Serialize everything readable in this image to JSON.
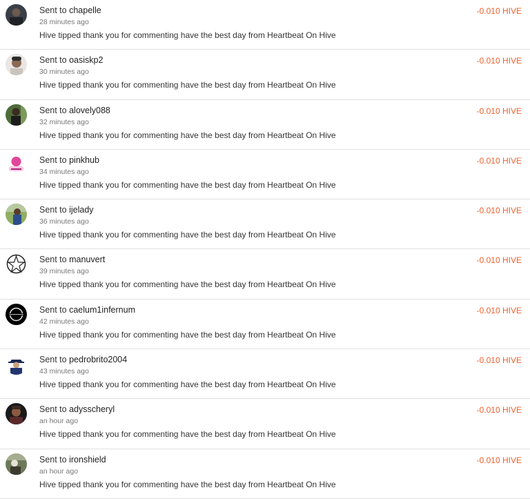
{
  "transfers": [
    {
      "prefix": "Sent to",
      "user": "chapelle",
      "time": "28 minutes ago",
      "memo": "Hive tipped thank you for commenting have the best day from Heartbeat On Hive",
      "amount": "-0.010 HIVE"
    },
    {
      "prefix": "Sent to",
      "user": "oasiskp2",
      "time": "30 minutes ago",
      "memo": "Hive tipped thank you for commenting have the best day from Heartbeat On Hive",
      "amount": "-0.010 HIVE"
    },
    {
      "prefix": "Sent to",
      "user": "alovely088",
      "time": "32 minutes ago",
      "memo": "Hive tipped thank you for commenting have the best day from Heartbeat On Hive",
      "amount": "-0.010 HIVE"
    },
    {
      "prefix": "Sent to",
      "user": "pinkhub",
      "time": "34 minutes ago",
      "memo": "Hive tipped thank you for commenting have the best day from Heartbeat On Hive",
      "amount": "-0.010 HIVE"
    },
    {
      "prefix": "Sent to",
      "user": "ijelady",
      "time": "36 minutes ago",
      "memo": "Hive tipped thank you for commenting have the best day from Heartbeat On Hive",
      "amount": "-0.010 HIVE"
    },
    {
      "prefix": "Sent to",
      "user": "manuvert",
      "time": "39 minutes ago",
      "memo": "Hive tipped thank you for commenting have the best day from Heartbeat On Hive",
      "amount": "-0.010 HIVE"
    },
    {
      "prefix": "Sent to",
      "user": "caelum1infernum",
      "time": "42 minutes ago",
      "memo": "Hive tipped thank you for commenting have the best day from Heartbeat On Hive",
      "amount": "-0.010 HIVE"
    },
    {
      "prefix": "Sent to",
      "user": "pedrobrito2004",
      "time": "43 minutes ago",
      "memo": "Hive tipped thank you for commenting have the best day from Heartbeat On Hive",
      "amount": "-0.010 HIVE"
    },
    {
      "prefix": "Sent to",
      "user": "adysscheryl",
      "time": "an hour ago",
      "memo": "Hive tipped thank you for commenting have the best day from Heartbeat On Hive",
      "amount": "-0.010 HIVE"
    },
    {
      "prefix": "Sent to",
      "user": "ironshield",
      "time": "an hour ago",
      "memo": "Hive tipped thank you for commenting have the best day from Heartbeat On Hive",
      "amount": "-0.010 HIVE"
    }
  ],
  "colors": {
    "amount": "#f0602d",
    "divider": "#e0e0e0",
    "muted": "#777777"
  }
}
